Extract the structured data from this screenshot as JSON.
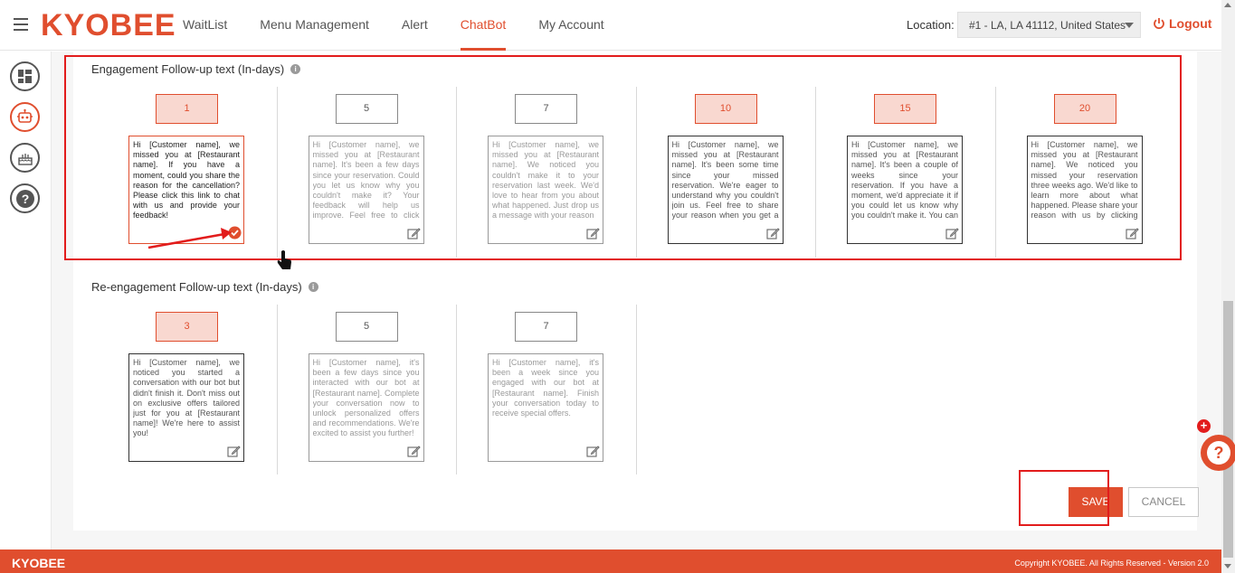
{
  "header": {
    "logo": "KYOBEE",
    "nav": [
      "WaitList",
      "Menu Management",
      "Alert",
      "ChatBot",
      "My Account"
    ],
    "active_nav": "ChatBot",
    "location_label": "Location:",
    "location_value": "#1 - LA, LA 41112, United States",
    "logout": "Logout"
  },
  "sidebar": {
    "icons": [
      "dashboard-icon",
      "chatbot-icon",
      "cake-icon",
      "help-icon"
    ],
    "active": "chatbot-icon"
  },
  "engagement": {
    "title": "Engagement Follow-up text (In-days)",
    "columns": [
      {
        "days": "1",
        "highlighted": true,
        "message": "Hi [Customer name], we missed you at [Restaurant name]. If you have a moment, could you share the reason for the cancellation? Please click this link to chat with us and provide your feedback!"
      },
      {
        "days": "5",
        "highlighted": false,
        "message": "Hi [Customer name], we missed you at [Restaurant name]. It's been a few days since your reservation. Could you let us know why you couldn't make it? Your feedback will help us improve. Feel free to click this"
      },
      {
        "days": "7",
        "highlighted": false,
        "message": "Hi [Customer name], we missed you at [Restaurant name]. We noticed you couldn't make it to your reservation last week. We'd love to hear from you about what happened. Just drop us a message with your reason"
      },
      {
        "days": "10",
        "highlighted": true,
        "message": "Hi [Customer name], we missed you at [Restaurant name]. It's been some time since your missed reservation. We're eager to understand why you couldn't join us. Feel free to share your reason when you get a chance"
      },
      {
        "days": "15",
        "highlighted": true,
        "message": "Hi [Customer name], we missed you at [Restaurant name]. It's been a couple of weeks since your reservation. If you have a moment, we'd appreciate it if you could let us know why you couldn't make it. You can share your"
      },
      {
        "days": "20",
        "highlighted": true,
        "message": "Hi [Customer name], we missed you at [Restaurant name]. We noticed you missed your reservation three weeks ago. We'd like to learn more about what happened. Please share your reason with us by clicking this link to chat"
      }
    ]
  },
  "reengagement": {
    "title": "Re-engagement Follow-up text (In-days)",
    "columns": [
      {
        "days": "3",
        "highlighted": true,
        "message": "Hi [Customer name], we noticed you started a conversation with our bot but didn't finish it. Don't miss out on exclusive offers tailored just for you at [Restaurant name]! We're here to assist you!"
      },
      {
        "days": "5",
        "highlighted": false,
        "message": "Hi [Customer name], it's been a few days since you interacted with our bot at [Restaurant name]. Complete your conversation now to unlock personalized offers and recommendations. We're excited to assist you further!"
      },
      {
        "days": "7",
        "highlighted": false,
        "message": "Hi [Customer name], it's been a week since you engaged with our bot at [Restaurant name]. Finish your conversation today to receive special offers."
      }
    ]
  },
  "buttons": {
    "save": "SAVE",
    "cancel": "CANCEL"
  },
  "footer": {
    "logo": "KYOBEE",
    "copyright": "Copyright KYOBEE. All Rights Reserved - Version 2.0"
  },
  "colors": {
    "accent": "#e04e2e",
    "highlight_frame": "#e21c1c"
  }
}
